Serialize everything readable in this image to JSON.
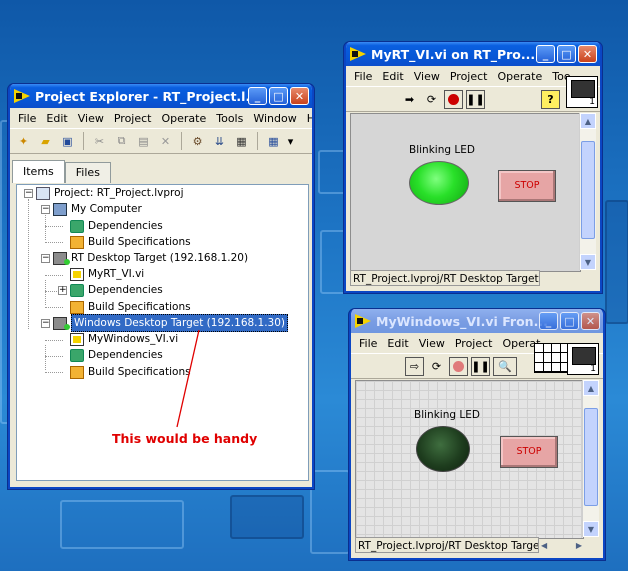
{
  "colors": {
    "desktop": "#1a6cc0",
    "title_active": "#0757d6",
    "title_inactive": "#7a9de3",
    "selection": "#316ac5",
    "annotation": "#e00000",
    "led_on": "#22dd22",
    "led_off": "#1e3d1e",
    "stop_button": "#e6a5a5"
  },
  "project_explorer": {
    "title": "Project Explorer - RT_Project.l...",
    "menu": [
      "File",
      "Edit",
      "View",
      "Project",
      "Operate",
      "Tools",
      "Window",
      "Hel"
    ],
    "tabs": [
      {
        "label": "Items",
        "active": true
      },
      {
        "label": "Files",
        "active": false
      }
    ],
    "tree": [
      {
        "label": "Project: RT_Project.lvproj",
        "icon": "project-icon",
        "depth": 0
      },
      {
        "label": "My Computer",
        "icon": "computer-icon",
        "depth": 1
      },
      {
        "label": "Dependencies",
        "icon": "dependencies-icon",
        "depth": 2
      },
      {
        "label": "Build Specifications",
        "icon": "build-spec-icon",
        "depth": 2
      },
      {
        "label": "RT Desktop Target (192.168.1.20)",
        "icon": "rt-target-icon",
        "depth": 1
      },
      {
        "label": "MyRT_VI.vi",
        "icon": "vi-icon",
        "depth": 2
      },
      {
        "label": "Dependencies",
        "icon": "dependencies-icon",
        "depth": 2
      },
      {
        "label": "Build Specifications",
        "icon": "build-spec-icon",
        "depth": 2
      },
      {
        "label": "Windows Desktop Target (192.168.1.30)",
        "icon": "rt-target-icon",
        "depth": 1,
        "selected": true
      },
      {
        "label": "MyWindows_VI.vi",
        "icon": "vi-icon",
        "depth": 2
      },
      {
        "label": "Dependencies",
        "icon": "dependencies-icon",
        "depth": 2
      },
      {
        "label": "Build Specifications",
        "icon": "build-spec-icon",
        "depth": 2
      }
    ],
    "annotation": "This would be handy"
  },
  "rt_vi_window": {
    "title": "MyRT_VI.vi on RT_Pro...",
    "menu": [
      "File",
      "Edit",
      "View",
      "Project",
      "Operate",
      "Too"
    ],
    "led_label": "Blinking LED",
    "led_state": "on",
    "stop_label": "STOP",
    "status": "RT_Project.lvproj/RT Desktop Target",
    "icon_number": "1"
  },
  "windows_vi_window": {
    "title": "MyWindows_VI.vi Fron...",
    "menu": [
      "File",
      "Edit",
      "View",
      "Project",
      "Operat"
    ],
    "led_label": "Blinking LED",
    "led_state": "off",
    "stop_label": "STOP",
    "status": "RT_Project.lvproj/RT Desktop Target",
    "icon_number": "1"
  }
}
